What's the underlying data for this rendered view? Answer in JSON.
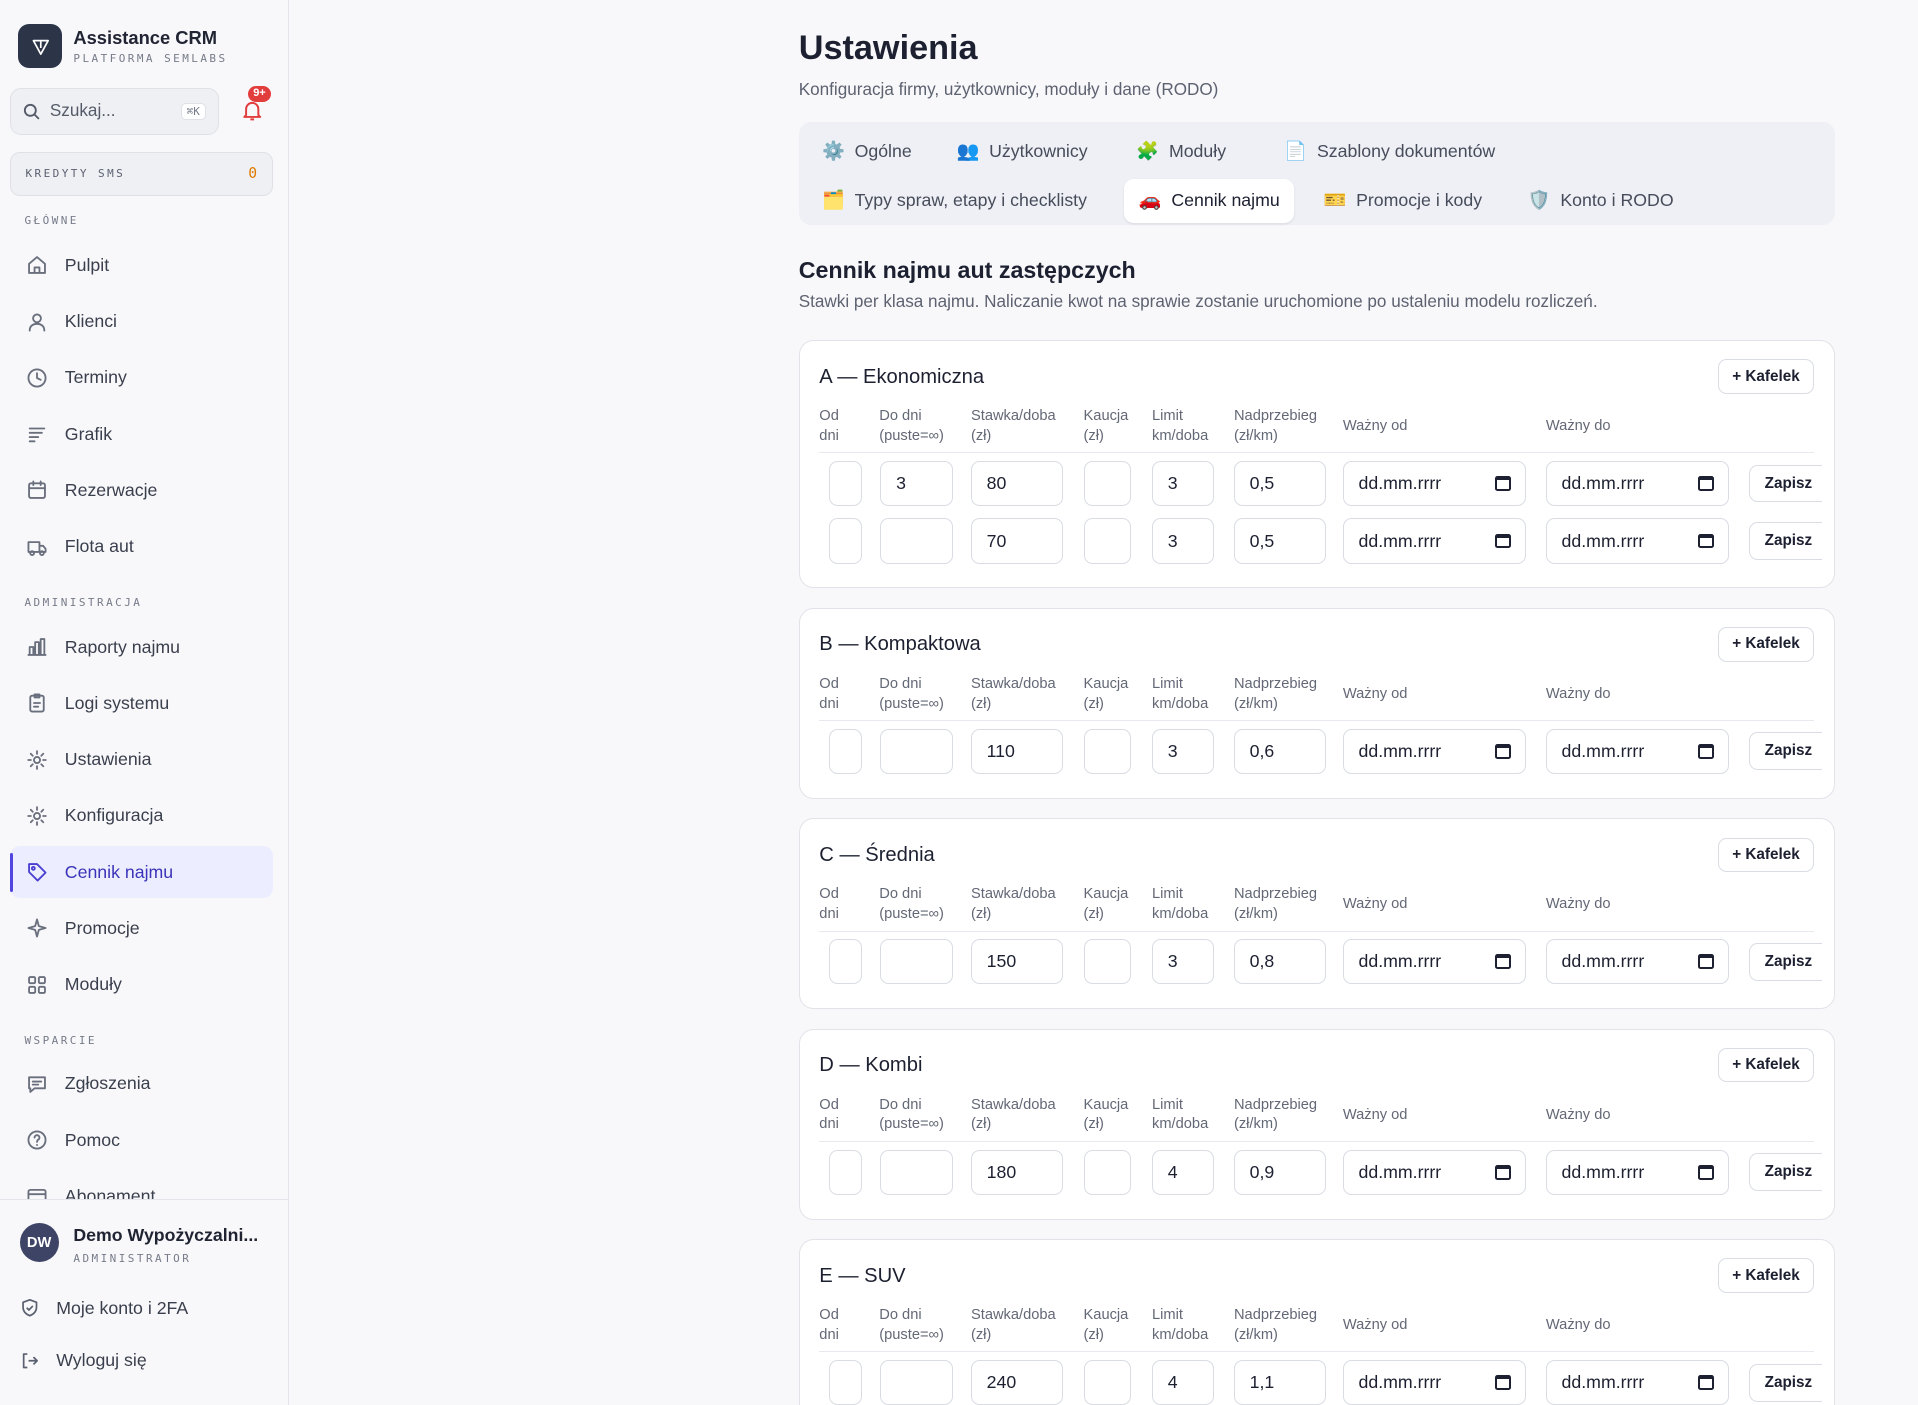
{
  "sidebar": {
    "app_name": "Assistance CRM",
    "app_subtitle": "PLATFORMA SEMLABS",
    "search_placeholder": "Szukaj...",
    "search_shortcut": "⌘K",
    "notification_badge": "9+",
    "sms_label": "KREDYTY SMS",
    "sms_value": "0",
    "sections": [
      {
        "label": "GŁÓWNE",
        "items": [
          {
            "label": "Pulpit",
            "icon": "home-icon"
          },
          {
            "label": "Klienci",
            "icon": "user-icon"
          },
          {
            "label": "Terminy",
            "icon": "clock-icon"
          },
          {
            "label": "Grafik",
            "icon": "lines-icon"
          },
          {
            "label": "Rezerwacje",
            "icon": "calendar-icon"
          },
          {
            "label": "Flota aut",
            "icon": "truck-icon"
          }
        ]
      },
      {
        "label": "ADMINISTRACJA",
        "items": [
          {
            "label": "Raporty najmu",
            "icon": "bar-chart-icon"
          },
          {
            "label": "Logi systemu",
            "icon": "clipboard-icon"
          },
          {
            "label": "Ustawienia",
            "icon": "gear-icon"
          },
          {
            "label": "Konfiguracja",
            "icon": "gear-icon"
          },
          {
            "label": "Cennik najmu",
            "icon": "tag-icon",
            "active": true
          },
          {
            "label": "Promocje",
            "icon": "sparkle-icon"
          },
          {
            "label": "Moduły",
            "icon": "grid-icon"
          }
        ]
      },
      {
        "label": "WSPARCIE",
        "items": [
          {
            "label": "Zgłoszenia",
            "icon": "message-icon"
          },
          {
            "label": "Pomoc",
            "icon": "help-icon"
          },
          {
            "label": "Abonament",
            "icon": "card-icon"
          }
        ]
      }
    ],
    "user": {
      "initials": "DW",
      "name": "Demo Wypożyczalni...",
      "role": "ADMINISTRATOR"
    },
    "account_link": "Moje konto i 2FA",
    "logout_link": "Wyloguj się"
  },
  "page": {
    "title": "Ustawienia",
    "subtitle": "Konfiguracja firmy, użytkownicy, moduły i dane (RODO)",
    "tabs": [
      {
        "label": "Ogólne",
        "icon": "⚙️"
      },
      {
        "label": "Użytkownicy",
        "icon": "👥"
      },
      {
        "label": "Moduły",
        "icon": "🧩"
      },
      {
        "label": "Szablony dokumentów",
        "icon": "📄"
      },
      {
        "label": "Typy spraw, etapy i checklisty",
        "icon": "🗂️"
      },
      {
        "label": "Cennik najmu",
        "icon": "🚗",
        "active": true
      },
      {
        "label": "Promocje i kody",
        "icon": "🎫"
      },
      {
        "label": "Konto i RODO",
        "icon": "🛡️"
      }
    ],
    "section_title": "Cennik najmu aut zastępczych",
    "section_desc": "Stawki per klasa najmu. Naliczanie kwot na sprawie zostanie uruchomione po ustaleniu modelu rozliczeń."
  },
  "columns": [
    "Od\ndni",
    "Do dni\n(puste=∞)",
    "Stawka/doba\n(zł)",
    "Kaucja\n(zł)",
    "Limit\nkm/doba",
    "Nadprzebieg\n(zł/km)",
    "Ważny od",
    "Ważny do"
  ],
  "add_label": "+ Kafelek",
  "save_label": "Zapisz",
  "date_placeholder": "dd.mm.rrrr",
  "classes": [
    {
      "name": "A — Ekonomiczna",
      "rows": [
        {
          "od": "",
          "do": "3",
          "stawka": "80",
          "kaucja": "",
          "limit": "3",
          "nadprzebieg": "0,5"
        },
        {
          "od": "",
          "do": "",
          "stawka": "70",
          "kaucja": "",
          "limit": "3",
          "nadprzebieg": "0,5"
        }
      ]
    },
    {
      "name": "B — Kompaktowa",
      "rows": [
        {
          "od": "",
          "do": "",
          "stawka": "110",
          "kaucja": "",
          "limit": "3",
          "nadprzebieg": "0,6"
        }
      ]
    },
    {
      "name": "C — Średnia",
      "rows": [
        {
          "od": "",
          "do": "",
          "stawka": "150",
          "kaucja": "",
          "limit": "3",
          "nadprzebieg": "0,8"
        }
      ]
    },
    {
      "name": "D — Kombi",
      "rows": [
        {
          "od": "",
          "do": "",
          "stawka": "180",
          "kaucja": "",
          "limit": "4",
          "nadprzebieg": "0,9"
        }
      ]
    },
    {
      "name": "E — SUV",
      "rows": [
        {
          "od": "",
          "do": "",
          "stawka": "240",
          "kaucja": "",
          "limit": "4",
          "nadprzebieg": "1,1"
        }
      ]
    }
  ]
}
